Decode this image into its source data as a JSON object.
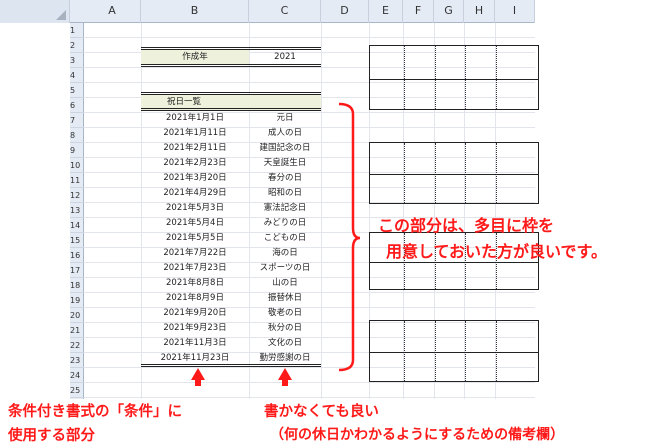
{
  "columns": [
    "A",
    "B",
    "C",
    "D",
    "E",
    "F",
    "G",
    "H",
    "I"
  ],
  "rows": [
    "1",
    "2",
    "3",
    "4",
    "5",
    "6",
    "7",
    "8",
    "9",
    "10",
    "11",
    "12",
    "13",
    "14",
    "15",
    "16",
    "17",
    "18",
    "19",
    "20",
    "21",
    "22",
    "23",
    "24",
    "25"
  ],
  "sheet": {
    "created_year_label": "作成年",
    "created_year_value": "2021",
    "holiday_header": "祝日一覧",
    "holidays": [
      {
        "date": "2021年1月1日",
        "name": "元日"
      },
      {
        "date": "2021年1月11日",
        "name": "成人の日"
      },
      {
        "date": "2021年2月11日",
        "name": "建国記念の日"
      },
      {
        "date": "2021年2月23日",
        "name": "天皇誕生日"
      },
      {
        "date": "2021年3月20日",
        "name": "春分の日"
      },
      {
        "date": "2021年4月29日",
        "name": "昭和の日"
      },
      {
        "date": "2021年5月3日",
        "name": "憲法記念日"
      },
      {
        "date": "2021年5月4日",
        "name": "みどりの日"
      },
      {
        "date": "2021年5月5日",
        "name": "こどもの日"
      },
      {
        "date": "2021年7月22日",
        "name": "海の日"
      },
      {
        "date": "2021年7月23日",
        "name": "スポーツの日"
      },
      {
        "date": "2021年8月8日",
        "name": "山の日"
      },
      {
        "date": "2021年8月9日",
        "name": "振替休日"
      },
      {
        "date": "2021年9月20日",
        "name": "敬老の日"
      },
      {
        "date": "2021年9月23日",
        "name": "秋分の日"
      },
      {
        "date": "2021年11月3日",
        "name": "文化の日"
      },
      {
        "date": "2021年11月23日",
        "name": "勤労感謝の日"
      }
    ]
  },
  "annotations": {
    "right_line1": "この部分は、多目に枠を",
    "right_line2": "用意しておいた方が良いです。",
    "bottom_left_line1": "条件付き書式の「条件」に",
    "bottom_left_line2": "使用する部分",
    "bottom_mid_line1": "書かなくても良い",
    "bottom_mid_line2": "（何の休日かわかるようにするための備考欄）"
  },
  "colors": {
    "annotation": "#ff1a1a",
    "header_fill": "#eef2dd"
  }
}
